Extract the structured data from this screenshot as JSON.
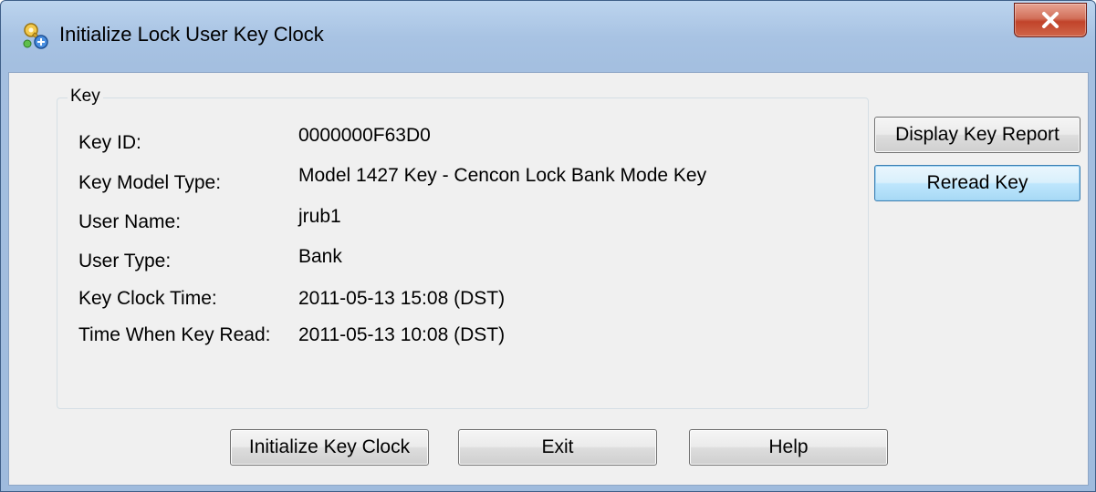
{
  "window": {
    "title": "Initialize Lock User Key Clock",
    "icon": "key-app-icon",
    "close_icon": "close-icon"
  },
  "group": {
    "title": "Key",
    "fields": [
      {
        "label": "Key ID:",
        "value": "0000000F63D0"
      },
      {
        "label": "Key Model Type:",
        "value": "Model 1427 Key - Cencon Lock Bank Mode Key"
      },
      {
        "label": "User Name:",
        "value": "jrub1"
      },
      {
        "label": "User Type:",
        "value": "Bank"
      },
      {
        "label": "Key Clock Time:",
        "value": "2011-05-13 15:08 (DST)"
      },
      {
        "label": "Time When Key Read:",
        "value": "2011-05-13 10:08 (DST)"
      }
    ]
  },
  "side_buttons": {
    "display_report": "Display Key Report",
    "reread": "Reread Key"
  },
  "bottom_buttons": {
    "initialize": "Initialize Key Clock",
    "exit": "Exit",
    "help": "Help"
  },
  "colors": {
    "frame": "#a8c3e3",
    "client": "#f0f0f0",
    "close": "#c1432a",
    "default_button_border": "#3c7fb1"
  }
}
